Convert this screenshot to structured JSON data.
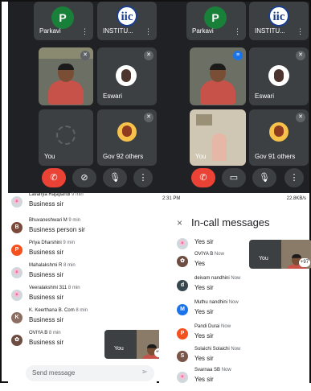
{
  "left_call": {
    "tiles": [
      {
        "name": "Parkavi",
        "avatar_letter": "P"
      },
      {
        "name": "INSTITU...",
        "logo_text": "iic"
      },
      {
        "name": "",
        "kind": "camera"
      },
      {
        "name": "Eswari"
      },
      {
        "name": "You"
      },
      {
        "name": "Gov 92 others"
      }
    ]
  },
  "right_call": {
    "tiles": [
      {
        "name": "Parkavi",
        "avatar_letter": "P"
      },
      {
        "name": "INSTITU...",
        "logo_text": "iic"
      },
      {
        "name": "",
        "kind": "camera"
      },
      {
        "name": "Eswari"
      },
      {
        "name": "You"
      },
      {
        "name": "Gov 91 others"
      }
    ]
  },
  "chat_left": {
    "messages": [
      {
        "author": "Lavanya Rajapandi",
        "time": "9 min",
        "text": "Business sir",
        "avatar": "img",
        "color": "#b0bec5"
      },
      {
        "author": "Bhuvaneshwari M",
        "time": "9 min",
        "text": "Business person sir",
        "avatar": "B",
        "color": "#7b4a3a"
      },
      {
        "author": "Priya Dharshini",
        "time": "9 min",
        "text": "Business sir",
        "avatar": "P",
        "color": "#f4511e"
      },
      {
        "author": "Mahalakshmi R",
        "time": "8 min",
        "text": "Business sir",
        "avatar": "img",
        "color": "#b0bec5"
      },
      {
        "author": "Veeralakshmi 311",
        "time": "8 min",
        "text": "Business sir",
        "avatar": "img",
        "color": "#b0bec5"
      },
      {
        "author": "K. Keerthana B. Com",
        "time": "8 min",
        "text": "Business sir",
        "avatar": "K",
        "color": "#8d6e63"
      },
      {
        "author": "OVIYA B",
        "time": "8 min",
        "text": "Business sir",
        "avatar": "img",
        "color": "#6d4c41"
      }
    ],
    "pip_you": "You",
    "pip_count": "+96",
    "input_placeholder": "Send message"
  },
  "chat_right": {
    "status_bar_time": "2:31 PM",
    "status_bar_right": "22.8KB/s",
    "title": "In-call messages",
    "messages": [
      {
        "author": "",
        "time": "",
        "text": "Yes sir",
        "avatar": "img",
        "color": "#b0bec5"
      },
      {
        "author": "OVIYA B",
        "time": "Now",
        "text": "Yes",
        "avatar": "img",
        "color": "#6d4c41"
      },
      {
        "author": "deivam nandhini",
        "time": "Now",
        "text": "Yes sir",
        "avatar": "d",
        "color": "#37474f"
      },
      {
        "author": "Muthu nandhini",
        "time": "Now",
        "text": "Yes sir",
        "avatar": "M",
        "color": "#1a73e8"
      },
      {
        "author": "Pandi Durai",
        "time": "Now",
        "text": "Yes sir",
        "avatar": "P",
        "color": "#f4511e"
      },
      {
        "author": "Solaichi Solaichi",
        "time": "Now",
        "text": "Yes sir",
        "avatar": "S",
        "color": "#795548"
      },
      {
        "author": "Svarnaa SB",
        "time": "Now",
        "text": "Yes sir",
        "avatar": "img",
        "color": "#b0bec5"
      }
    ],
    "pip_you": "You",
    "pip_count": "+97"
  },
  "colors": {
    "call_bg": "#202124",
    "tile_bg": "#3c4043",
    "end_call": "#ea4335",
    "parkavi_green": "#188038"
  }
}
